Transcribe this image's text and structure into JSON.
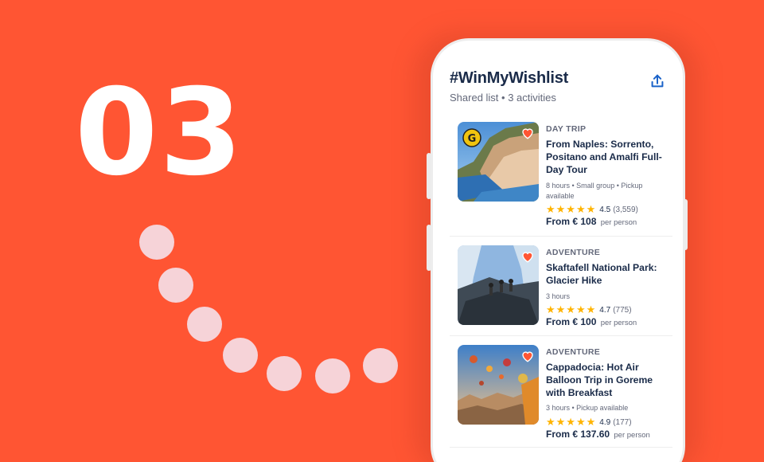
{
  "step_number": "03",
  "colors": {
    "background": "#FF5533",
    "dots": "#F6D3D8",
    "heading": "#1A2B49",
    "stars": "#FFB400",
    "heart": "#FF5533"
  },
  "wishlist": {
    "title": "#WinMyWishlist",
    "subtitle": "Shared list • 3 activities",
    "share_icon": "share-icon"
  },
  "activities": [
    {
      "category": "DAY TRIP",
      "title": "From Naples: Sorrento, Positano and Amalfi Full-Day Tour",
      "meta": "8 hours • Small group • Pickup available",
      "rating": "4.5",
      "reviews": "(3,559)",
      "price": "From € 108",
      "per": "per person",
      "badge": "G"
    },
    {
      "category": "ADVENTURE",
      "title": "Skaftafell National Park: Glacier Hike",
      "meta": "3 hours",
      "rating": "4.7",
      "reviews": "(775)",
      "price": "From € 100",
      "per": "per person"
    },
    {
      "category": "ADVENTURE",
      "title": "Cappadocia: Hot Air Balloon Trip in Goreme with Breakfast",
      "meta": "3 hours • Pickup available",
      "rating": "4.9",
      "reviews": "(177)",
      "price": "From € 137.60",
      "per": "per person"
    }
  ]
}
